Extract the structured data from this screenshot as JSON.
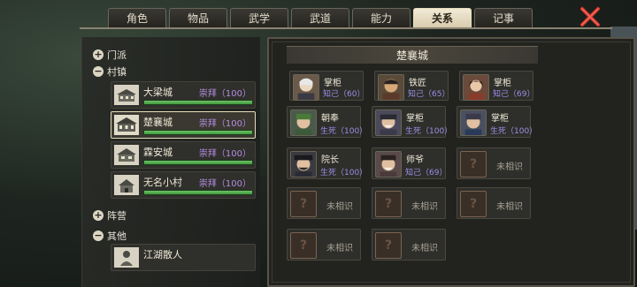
{
  "tabs": [
    "角色",
    "物品",
    "武学",
    "武道",
    "能力",
    "关系",
    "记事"
  ],
  "active_tab": "关系",
  "left": {
    "groups": [
      {
        "label": "门派",
        "sign": "+"
      },
      {
        "label": "村镇",
        "sign": "−"
      },
      {
        "label": "阵营",
        "sign": "+"
      },
      {
        "label": "其他",
        "sign": "−"
      }
    ],
    "towns": [
      {
        "name": "大梁城",
        "relation": "崇拜（100）",
        "progress": 1.0
      },
      {
        "name": "楚襄城",
        "relation": "崇拜（100）",
        "progress": 1.0
      },
      {
        "name": "霖安城",
        "relation": "崇拜（100）",
        "progress": 1.0
      },
      {
        "name": "无名小村",
        "relation": "崇拜（100）",
        "progress": 1.0
      }
    ],
    "other": [
      {
        "name": "江湖散人"
      }
    ]
  },
  "right": {
    "title": "楚襄城",
    "cards": [
      {
        "role": "掌柜",
        "relation": "知己（60）"
      },
      {
        "role": "铁匠",
        "relation": "知己（65）"
      },
      {
        "role": "掌柜",
        "relation": "知己（69）"
      },
      {
        "role": "朝奉",
        "relation": "生死（100）"
      },
      {
        "role": "掌柜",
        "relation": "生死（100）"
      },
      {
        "role": "掌柜",
        "relation": "生死（100）"
      },
      {
        "role": "院长",
        "relation": "生死（100）"
      },
      {
        "role": "师爷",
        "relation": "知己（69）"
      },
      {
        "unknown": "未相识"
      },
      {
        "unknown": "未相识"
      },
      {
        "unknown": "未相识"
      },
      {
        "unknown": "未相识"
      },
      {
        "unknown": "未相识"
      },
      {
        "unknown": "未相识"
      }
    ]
  }
}
